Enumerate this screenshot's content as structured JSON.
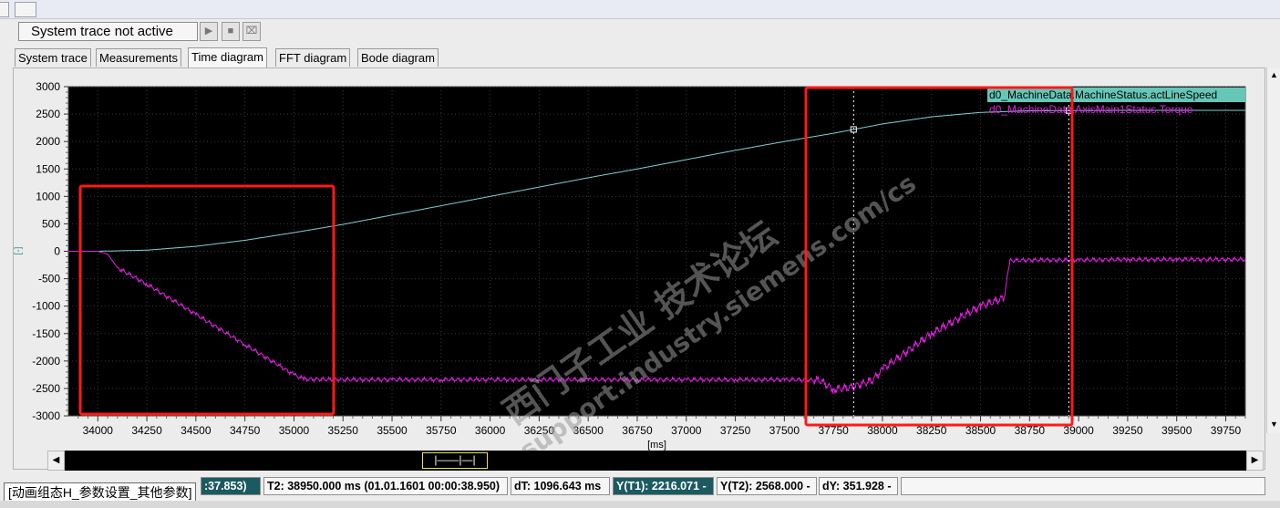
{
  "toolbar": {
    "status_text": "System trace not active",
    "play_icon": "play-icon",
    "stop_icon": "stop-icon",
    "clear_icon": "clear-icon"
  },
  "tabs": [
    {
      "label": "System trace",
      "active": false
    },
    {
      "label": "Measurements",
      "active": false
    },
    {
      "label": "Time diagram",
      "active": true
    },
    {
      "label": "FFT diagram",
      "active": false
    },
    {
      "label": "Bode diagram",
      "active": false
    }
  ],
  "chart_data": {
    "type": "line",
    "xlabel": "[ms]",
    "ylabel": "[-]",
    "xlim": [
      33850,
      39850
    ],
    "ylim": [
      -3000,
      3000
    ],
    "x_ticks": [
      34000,
      34250,
      34500,
      34750,
      35000,
      35250,
      35500,
      35750,
      36000,
      36250,
      36500,
      36750,
      37000,
      37250,
      37500,
      37750,
      38000,
      38250,
      38500,
      38750,
      39000,
      39250,
      39500,
      39750
    ],
    "y_ticks": [
      3000,
      2500,
      2000,
      1500,
      1000,
      500,
      0,
      -500,
      -1000,
      -1500,
      -2000,
      -2500,
      -3000
    ],
    "grid": true,
    "background": "#000000",
    "series": [
      {
        "name": "d0_MachineData.MachineStatus.actLineSpeed",
        "color": "#7fd3d6",
        "x": [
          33850,
          34000,
          34250,
          34500,
          34750,
          35000,
          35250,
          35500,
          35750,
          36000,
          36250,
          36500,
          36750,
          37000,
          37250,
          37500,
          37750,
          38000,
          38250,
          38500,
          38750,
          39000,
          39250,
          39500,
          39850
        ],
        "values": [
          0,
          0,
          20,
          90,
          200,
          340,
          490,
          660,
          830,
          1000,
          1170,
          1340,
          1500,
          1670,
          1840,
          2000,
          2150,
          2320,
          2450,
          2530,
          2560,
          2565,
          2568,
          2568,
          2568
        ]
      },
      {
        "name": "d0_MachineData.AxisMain1Status.Torque",
        "color": "#e020e0",
        "x": [
          33850,
          34000,
          34050,
          34100,
          34250,
          34500,
          34750,
          35000,
          35050,
          35250,
          35500,
          35750,
          36000,
          36250,
          36500,
          36750,
          37000,
          37250,
          37500,
          37680,
          37750,
          37850,
          37950,
          38000,
          38250,
          38500,
          38620,
          38650,
          38750,
          39000,
          39250,
          39500,
          39850
        ],
        "values": [
          0,
          0,
          -50,
          -300,
          -600,
          -1150,
          -1700,
          -2250,
          -2330,
          -2340,
          -2340,
          -2340,
          -2340,
          -2340,
          -2340,
          -2340,
          -2340,
          -2340,
          -2340,
          -2350,
          -2520,
          -2470,
          -2350,
          -2150,
          -1500,
          -1000,
          -850,
          -170,
          -160,
          -160,
          -150,
          -150,
          -150
        ]
      }
    ],
    "cursors": [
      {
        "label": "T1",
        "x": 37853
      },
      {
        "label": "T2",
        "x": 38950
      }
    ]
  },
  "status_bar": {
    "t1": ":37.853)",
    "t2": "T2: 38950.000 ms (01.01.1601 00:00:38.950)",
    "dt": "dT: 1096.643 ms",
    "y_t1": "Y(T1):  2216.071 -",
    "y_t2": "Y(T2): 2568.000 -",
    "dy": "dY: 351.928 -"
  },
  "tooltip": "[动画组态H_参数设置_其他参数]",
  "watermark": {
    "line1": "西门子工业 技术论坛",
    "line2": "support.industry.siemens.com/cs"
  },
  "scroll": {
    "thumb": "|——|—|"
  },
  "colors": {
    "annotation_box": "#ff1a1a",
    "cursor_line": "#ffffff",
    "legend_highlight": "#66c7b8"
  }
}
